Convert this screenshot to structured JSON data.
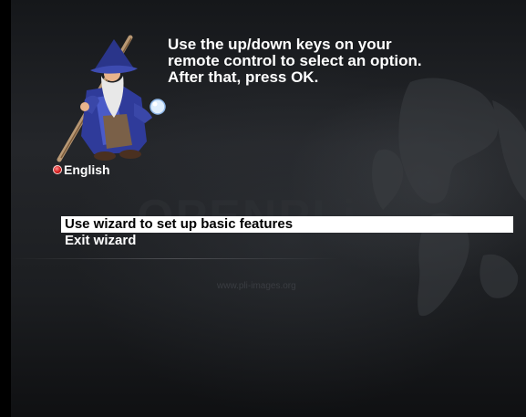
{
  "instructions": {
    "text": "Use the up/down keys on your\nremote control to select an option.\nAfter that, press OK."
  },
  "language": {
    "label": "English",
    "icon": "red-dot-icon",
    "color": "#d01818"
  },
  "watermark": {
    "logo_text": "OPENPLi",
    "url": "www.pli-images.org"
  },
  "menu": {
    "items": [
      {
        "label": "Use wizard to set up basic features",
        "selected": true
      },
      {
        "label": "Exit wizard",
        "selected": false
      }
    ]
  },
  "colors": {
    "background": "#1c1e21",
    "text": "#ffffff",
    "selection": "#ffffff"
  }
}
